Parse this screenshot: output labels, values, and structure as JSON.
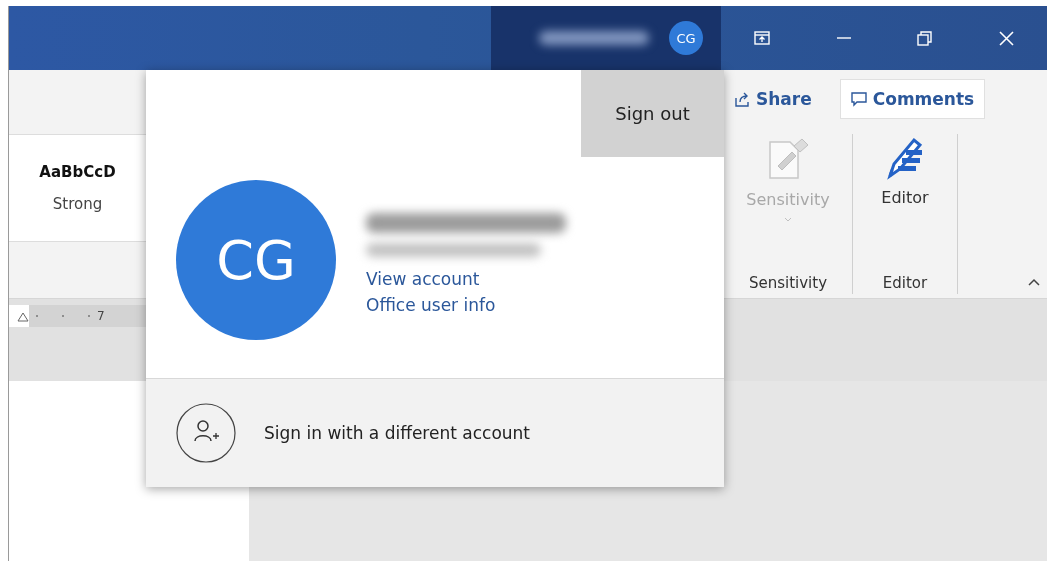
{
  "title_bar": {
    "avatar_initials": "CG",
    "controls": [
      {
        "kind": "ribbon-display"
      },
      {
        "kind": "minimize"
      },
      {
        "kind": "restore"
      },
      {
        "kind": "close"
      }
    ]
  },
  "ribbon": {
    "share": "Share",
    "comments": "Comments",
    "styles": [
      {
        "sample": "AaBbCcD",
        "name": "Strong"
      }
    ],
    "groups": [
      {
        "kind": "sensitivity",
        "button": "Sensitivity",
        "disabled": true,
        "label": "Sensitivity"
      },
      {
        "kind": "editor",
        "button": "Editor",
        "disabled": false,
        "label": "Editor"
      }
    ]
  },
  "ruler": {
    "label": "7"
  },
  "account_menu": {
    "sign_out": "Sign out",
    "avatar_initials": "CG",
    "links": [
      "View account",
      "Office user info"
    ],
    "switch_account": "Sign in with a different account"
  }
}
